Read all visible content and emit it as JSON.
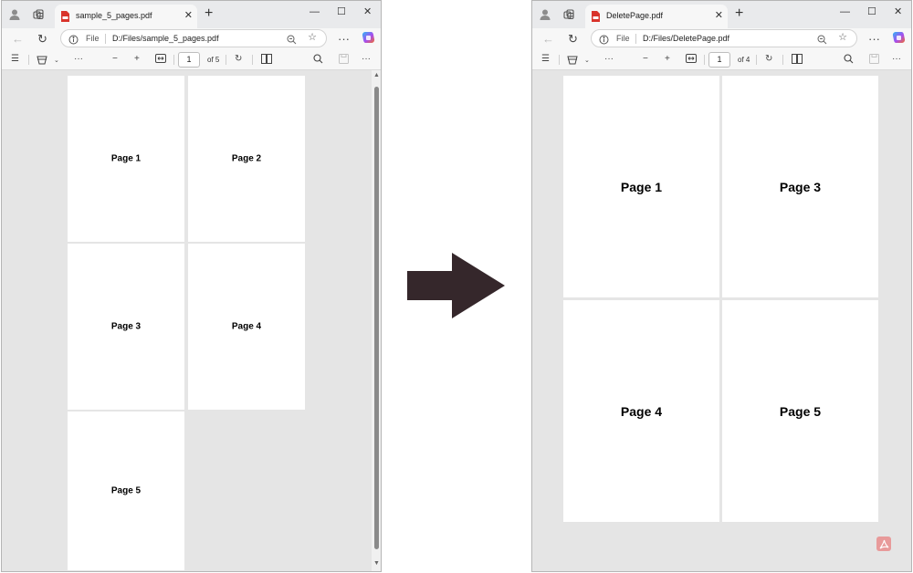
{
  "left_window": {
    "tab_title": "sample_5_pages.pdf",
    "file_label": "File",
    "url": "D:/Files/sample_5_pages.pdf",
    "current_page": "1",
    "page_count": "of 5",
    "pages": [
      "Page 1",
      "Page 2",
      "Page 3",
      "Page 4",
      "Page 5"
    ]
  },
  "right_window": {
    "tab_title": "DeletePage.pdf",
    "file_label": "File",
    "url": "D:/Files/DeletePage.pdf",
    "current_page": "1",
    "page_count": "of 4",
    "pages": [
      "Page 1",
      "Page 3",
      "Page 4",
      "Page 5"
    ]
  },
  "colors": {
    "arrow": "#35272b",
    "pdf_icon": "#d9342b",
    "copilot_gradient": [
      "#2fb5f5",
      "#a64df0",
      "#f26b2c"
    ]
  },
  "icons": {
    "titlebar": [
      "profile-icon",
      "workspaces-icon",
      "pdf-file-icon",
      "close-tab-icon",
      "new-tab-icon",
      "minimize-icon",
      "maximize-icon",
      "close-window-icon"
    ],
    "navigation": [
      "back-icon",
      "refresh-icon",
      "info-icon",
      "zoom-out-magnifier-icon",
      "favorite-star-icon",
      "more-icon",
      "copilot-icon"
    ],
    "pdf_toolbar": [
      "contents-icon",
      "draw-icon",
      "chevron-down-icon",
      "more-tools-icon",
      "zoom-minus-icon",
      "zoom-plus-icon",
      "fit-page-icon",
      "rotate-icon",
      "page-view-icon",
      "search-icon",
      "save-icon",
      "more-icon"
    ]
  }
}
